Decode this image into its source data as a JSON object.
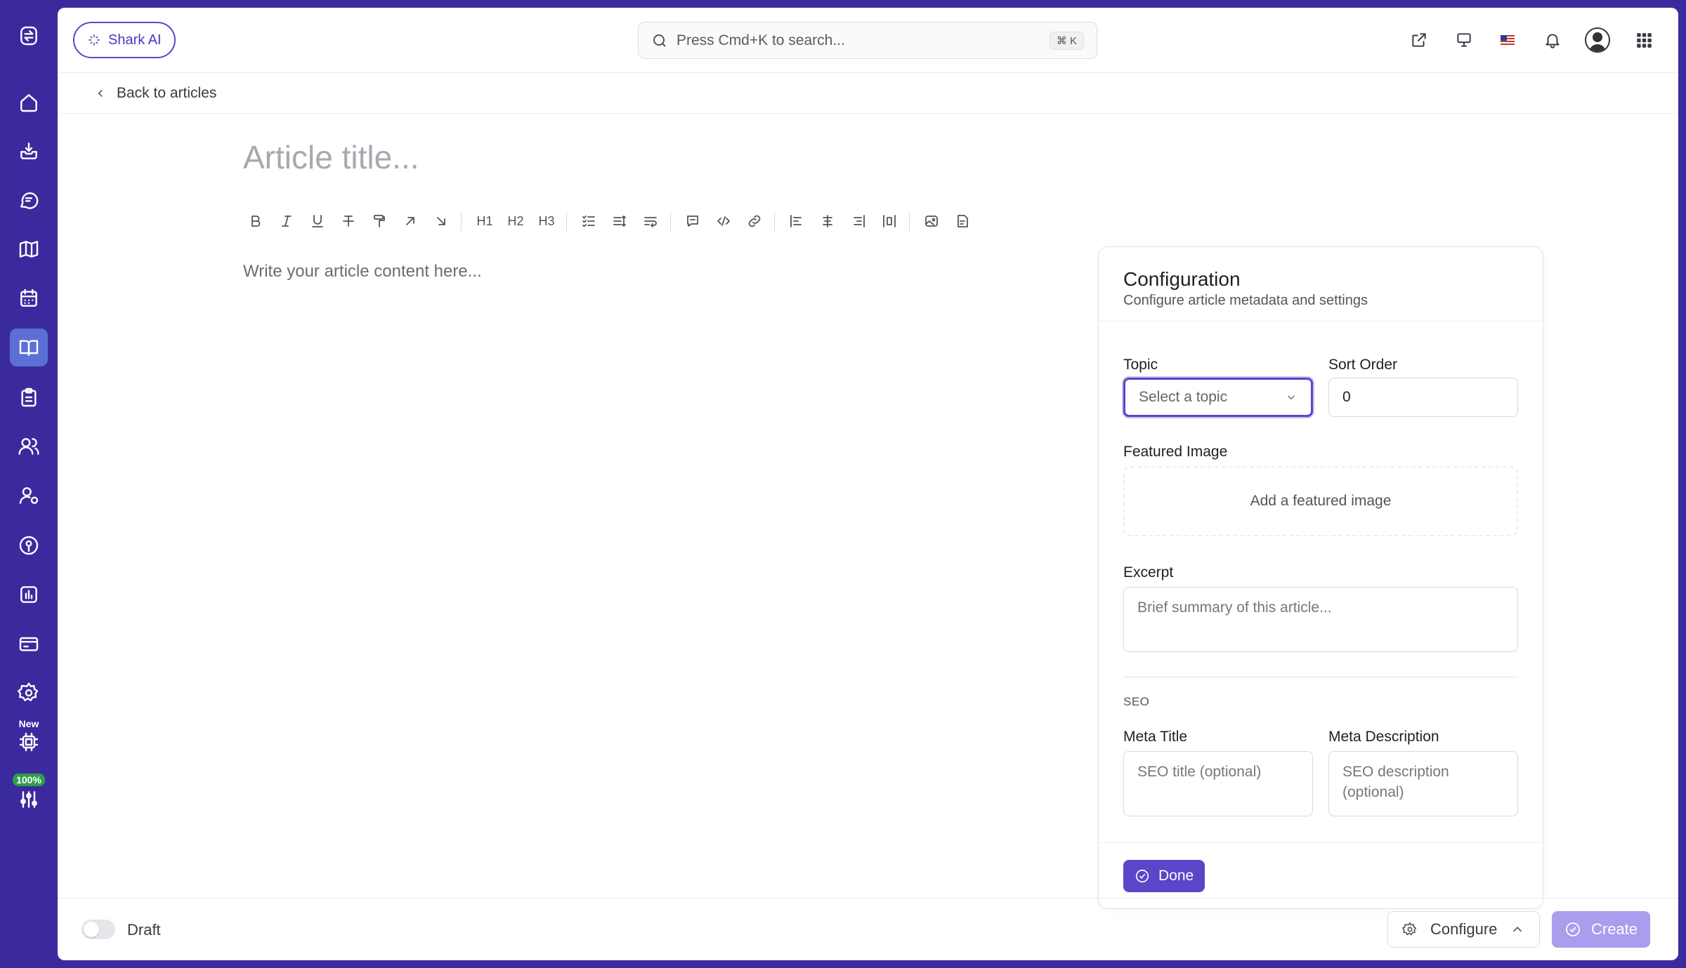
{
  "header": {
    "ai_button": "Shark AI",
    "search_placeholder": "Press Cmd+K to search...",
    "search_shortcut": "⌘ K"
  },
  "sidebar": {
    "items": [
      {
        "icon": "logo-icon"
      },
      {
        "icon": "home-icon"
      },
      {
        "icon": "inbox-icon"
      },
      {
        "icon": "chat-icon"
      },
      {
        "icon": "map-icon"
      },
      {
        "icon": "calendar-icon"
      },
      {
        "icon": "book-icon",
        "active": true
      },
      {
        "icon": "clipboard-icon"
      },
      {
        "icon": "users-icon"
      },
      {
        "icon": "user-settings-icon"
      },
      {
        "icon": "location-icon"
      },
      {
        "icon": "chart-icon"
      },
      {
        "icon": "card-icon"
      },
      {
        "icon": "settings-icon"
      },
      {
        "icon": "chip-icon",
        "badge": "New"
      },
      {
        "icon": "sliders-icon",
        "badge": "100%"
      }
    ]
  },
  "nav": {
    "back_label": "Back to articles"
  },
  "editor": {
    "title_placeholder": "Article title...",
    "content_placeholder": "Write your article content here...",
    "toolbar_headings": [
      "H1",
      "H2",
      "H3"
    ]
  },
  "config": {
    "title": "Configuration",
    "subtitle": "Configure article metadata and settings",
    "topic_label": "Topic",
    "topic_placeholder": "Select a topic",
    "sort_label": "Sort Order",
    "sort_value": "0",
    "image_label": "Featured Image",
    "image_placeholder": "Add a featured image",
    "excerpt_label": "Excerpt",
    "excerpt_placeholder": "Brief summary of this article...",
    "seo_heading": "SEO",
    "meta_title_label": "Meta Title",
    "meta_title_placeholder": "SEO title (optional)",
    "meta_desc_label": "Meta Description",
    "meta_desc_placeholder": "SEO description (optional)",
    "done_label": "Done"
  },
  "footer": {
    "draft_label": "Draft",
    "configure_label": "Configure",
    "create_label": "Create"
  },
  "colors": {
    "sidebar_bg": "#3a2a9e",
    "accent": "#5b45c9",
    "active_item": "#5c6fd6",
    "create_disabled": "#a99ded"
  }
}
